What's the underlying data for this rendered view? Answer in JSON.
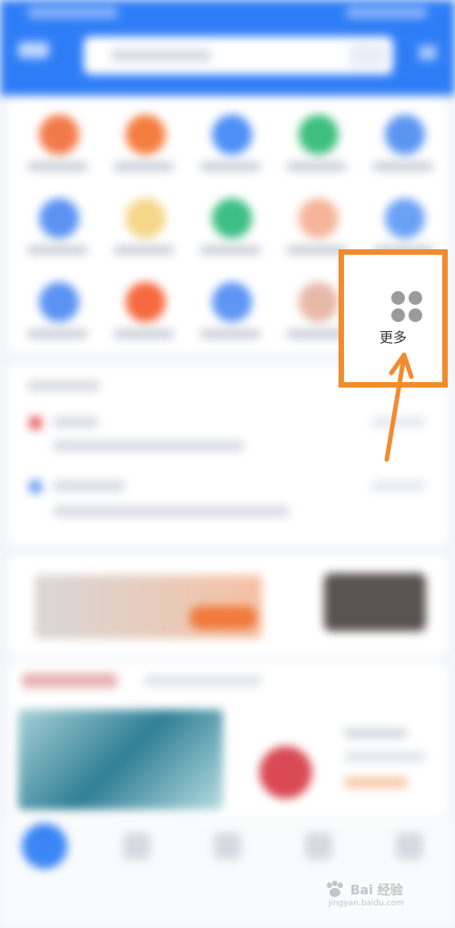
{
  "more_button": {
    "label": "更多",
    "icon": "grid-icon"
  },
  "annotation": {
    "box_color": "#f28a2e",
    "arrow_color": "#f28a2e"
  },
  "theme": {
    "primary": "#2f7df6"
  },
  "watermark": {
    "text": "Bai 经验",
    "sub": "jingyan.baidu.com"
  }
}
